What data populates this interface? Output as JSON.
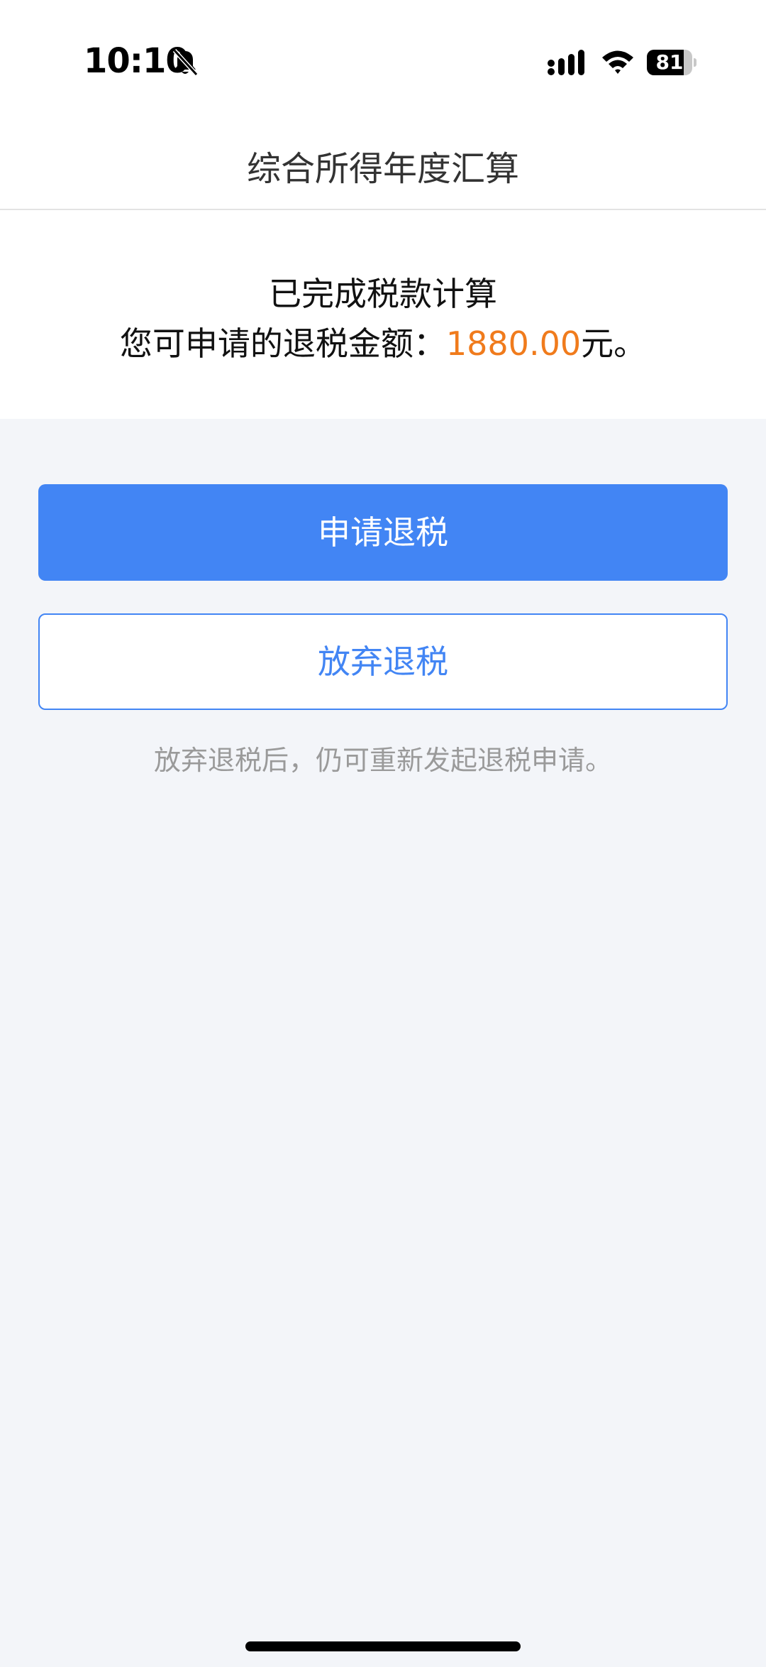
{
  "status_bar": {
    "time": "10:10",
    "battery_level": "81",
    "battery_fraction": 0.81,
    "icons": [
      "bell-slash-icon",
      "signal-icon",
      "wifi-icon",
      "battery-icon"
    ]
  },
  "nav": {
    "title": "综合所得年度汇算"
  },
  "result": {
    "title": "已完成税款计算",
    "amount_prefix": "您可申请的退税金额：",
    "amount": "1880.00",
    "amount_suffix": "元。"
  },
  "actions": {
    "apply_label": "申请退税",
    "abandon_label": "放弃退税",
    "hint": "放弃退税后，仍可重新发起退税申请。"
  },
  "colors": {
    "primary": "#4285f4",
    "amount": "#f07b1c",
    "background": "#f3f5f9",
    "hint": "#9a9a9a"
  }
}
